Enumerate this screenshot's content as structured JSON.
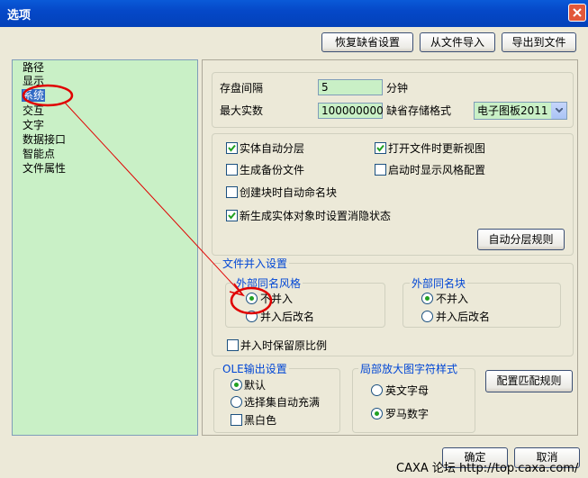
{
  "window": {
    "title": "选项"
  },
  "top_buttons": {
    "restore": "恢复缺省设置",
    "import": "从文件导入",
    "export": "导出到文件"
  },
  "tree": {
    "items": [
      "路径",
      "显示",
      "系统",
      "交互",
      "文字",
      "数据接口",
      "智能点",
      "文件属性"
    ],
    "selected": "系统"
  },
  "save": {
    "interval_label": "存盘间隔",
    "interval_value": "5",
    "interval_unit": "分钟",
    "max_label": "最大实数",
    "max_value": "100000000",
    "format_label": "缺省存储格式",
    "format_value": "电子图板2011"
  },
  "options": {
    "auto_layer": {
      "label": "实体自动分层",
      "checked": true
    },
    "update_view": {
      "label": "打开文件时更新视图",
      "checked": true
    },
    "backup": {
      "label": "生成备份文件",
      "checked": false
    },
    "show_style": {
      "label": "启动时显示风格配置",
      "checked": false
    },
    "auto_block_name": {
      "label": "创建块时自动命名块",
      "checked": false
    },
    "hide_state": {
      "label": "新生成实体对象时设置消隐状态",
      "checked": true
    },
    "auto_layer_rules": "自动分层规则"
  },
  "merge": {
    "legend": "文件并入设置",
    "style_group": {
      "legend": "外部同名风格",
      "opt1": "不并入",
      "opt2": "并入后改名",
      "selected": 1
    },
    "block_group": {
      "legend": "外部同名块",
      "opt1": "不并入",
      "opt2": "并入后改名",
      "selected": 1
    },
    "keep_ratio": {
      "label": "并入时保留原比例",
      "checked": false
    }
  },
  "ole": {
    "legend": "OLE输出设置",
    "default": "默认",
    "fill": "选择集自动充满",
    "selected": 1,
    "bw": {
      "label": "黑白色",
      "checked": false
    }
  },
  "zoom_style": {
    "legend": "局部放大图字符样式",
    "opt1": "英文字母",
    "opt2": "罗马数字",
    "selected": 2
  },
  "match_rules": "配置匹配规则",
  "ok": "确定",
  "cancel": "取消",
  "watermark": "CAXA 论坛 http://top.caxa.com/",
  "colors": {
    "field_bg": "#c9f0c6",
    "legend": "#0046d5",
    "annotation": "#e00000",
    "selection": "#316ac5"
  }
}
